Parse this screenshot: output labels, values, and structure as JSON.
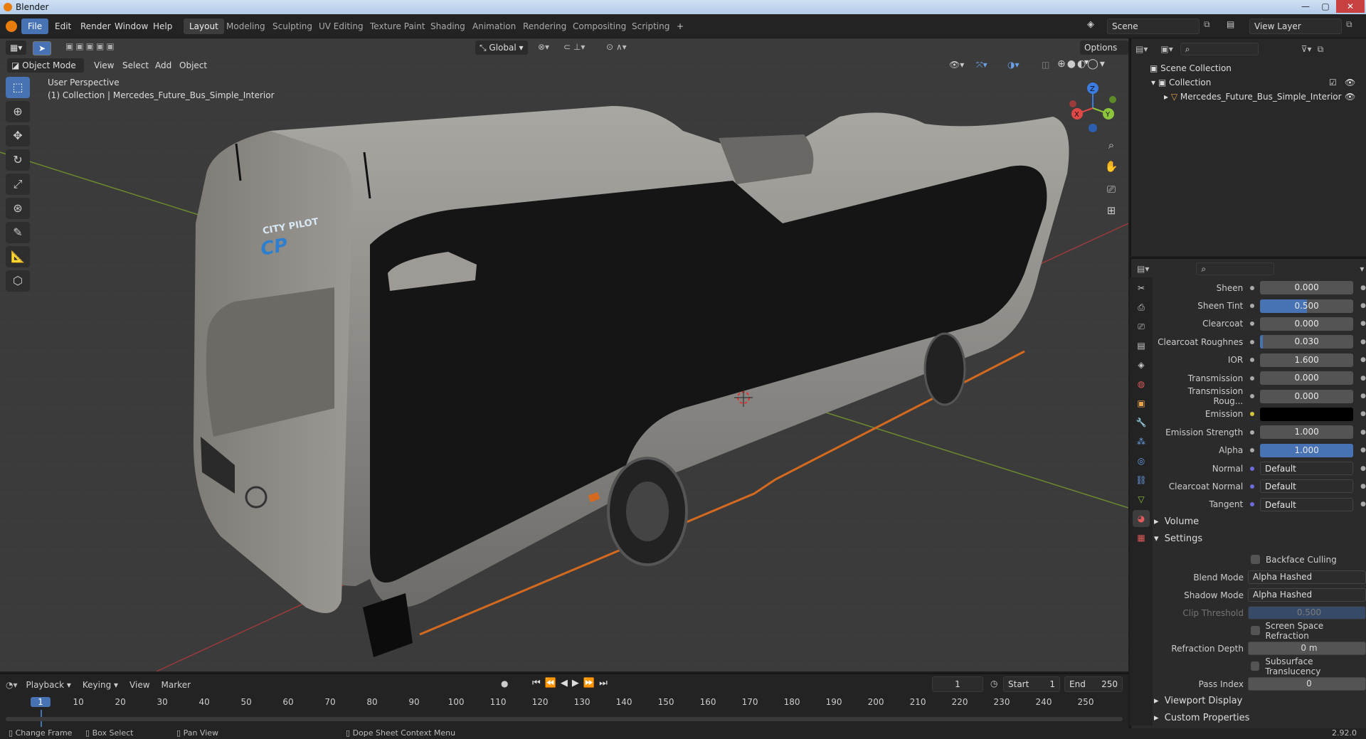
{
  "window": {
    "title": "Blender",
    "controls": [
      "minimize",
      "maximize",
      "close"
    ]
  },
  "menus": [
    "File",
    "Edit",
    "Render",
    "Window",
    "Help"
  ],
  "workspaces": [
    "Layout",
    "Modeling",
    "Sculpting",
    "UV Editing",
    "Texture Paint",
    "Shading",
    "Animation",
    "Rendering",
    "Compositing",
    "Scripting"
  ],
  "scene": {
    "name": "Scene",
    "view_layer": "View Layer"
  },
  "viewport_header": {
    "orientation": "Global",
    "options_label": "Options",
    "mode": "Object Mode",
    "menus": [
      "View",
      "Select",
      "Add",
      "Object"
    ]
  },
  "viewport": {
    "perspective": "User Perspective",
    "collection_info": "(1) Collection | Mercedes_Future_Bus_Simple_Interior",
    "bus_logo_line1": "CITY PILOT",
    "bus_logo_line2": "CP",
    "axis_labels": {
      "x": "X",
      "y": "Y",
      "z": "Z"
    }
  },
  "tools": [
    "select-box",
    "cursor",
    "move",
    "rotate",
    "scale",
    "transform",
    "annotate",
    "measure",
    "add-cube"
  ],
  "outliner": {
    "root": "Scene Collection",
    "collection": "Collection",
    "object": "Mercedes_Future_Bus_Simple_Interior"
  },
  "properties": {
    "rows": [
      {
        "label": "Sheen",
        "value": "0.000",
        "fill": 0
      },
      {
        "label": "Sheen Tint",
        "value": "0.500",
        "fill": 0.5
      },
      {
        "label": "Clearcoat",
        "value": "0.000",
        "fill": 0
      },
      {
        "label": "Clearcoat Roughnes",
        "value": "0.030",
        "fill": 0.03
      },
      {
        "label": "IOR",
        "value": "1.600",
        "fill": 0
      },
      {
        "label": "Transmission",
        "value": "0.000",
        "fill": 0
      },
      {
        "label": "Transmission Roug...",
        "value": "0.000",
        "fill": 0
      },
      {
        "label": "Emission",
        "value": "",
        "fill": 0
      },
      {
        "label": "Emission Strength",
        "value": "1.000",
        "fill": 0
      },
      {
        "label": "Alpha",
        "value": "1.000",
        "fill": 1
      },
      {
        "label": "Normal",
        "value": "Default",
        "fill": 0
      },
      {
        "label": "Clearcoat Normal",
        "value": "Default",
        "fill": 0
      },
      {
        "label": "Tangent",
        "value": "Default",
        "fill": 0
      }
    ],
    "volume_label": "Volume",
    "settings_label": "Settings",
    "backface_culling": "Backface Culling",
    "blend_mode_label": "Blend Mode",
    "blend_mode_value": "Alpha Hashed",
    "shadow_mode_label": "Shadow Mode",
    "shadow_mode_value": "Alpha Hashed",
    "clip_threshold_label": "Clip Threshold",
    "clip_threshold_value": "0.500",
    "screen_space_refraction": "Screen Space Refraction",
    "refraction_depth_label": "Refraction Depth",
    "refraction_depth_value": "0 m",
    "subsurface_translucency": "Subsurface Translucency",
    "pass_index_label": "Pass Index",
    "pass_index_value": "0",
    "viewport_display": "Viewport Display",
    "custom_properties": "Custom Properties",
    "emission_color": "#000000"
  },
  "timeline": {
    "menus": [
      "Playback",
      "Keying",
      "View",
      "Marker"
    ],
    "current_frame": "1",
    "start_label": "Start",
    "start": "1",
    "end_label": "End",
    "end": "250",
    "ticks": [
      "1",
      "10",
      "20",
      "30",
      "40",
      "50",
      "60",
      "70",
      "80",
      "90",
      "100",
      "110",
      "120",
      "130",
      "140",
      "150",
      "160",
      "170",
      "180",
      "190",
      "200",
      "210",
      "220",
      "230",
      "240",
      "250"
    ]
  },
  "statusbar": {
    "items": [
      "Change Frame",
      "Box Select",
      "Pan View",
      "Dope Sheet Context Menu"
    ],
    "version": "2.92.0"
  },
  "colors": {
    "accent": "#4772b3",
    "bus_body": "#8c8a86",
    "bus_stripe": "#d46a1f",
    "viewport_bg": "#3b3b3b"
  }
}
